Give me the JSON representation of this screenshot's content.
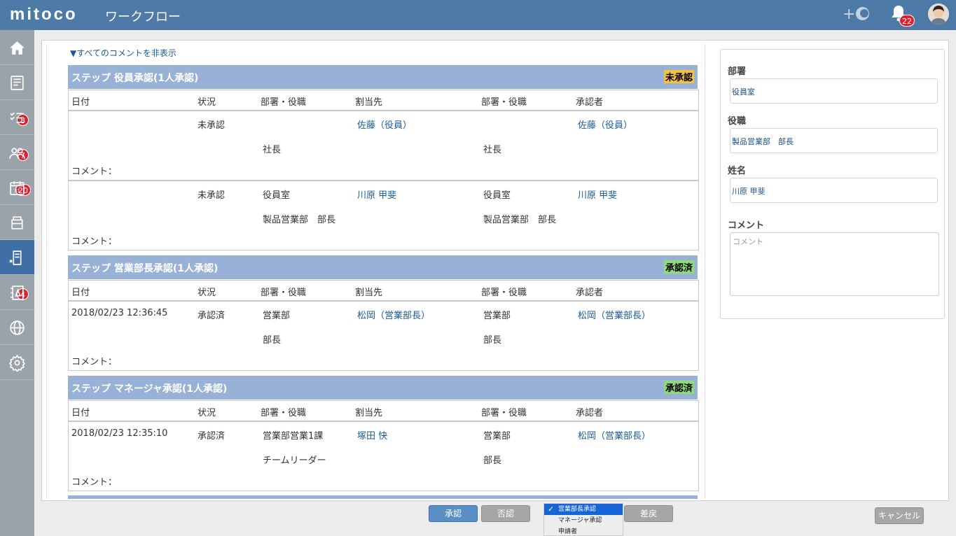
{
  "app": {
    "logo": "mitoco",
    "title": "ワークフロー"
  },
  "header": {
    "notification_count": "22"
  },
  "sidebar": {
    "items": [
      {
        "icon": "home-icon",
        "badge": ""
      },
      {
        "icon": "news-icon",
        "badge": "8"
      },
      {
        "icon": "todo-icon",
        "badge": "7"
      },
      {
        "icon": "group-icon",
        "badge": "20"
      },
      {
        "icon": "calendar-icon",
        "badge": ""
      },
      {
        "icon": "cabinet-icon",
        "badge": ""
      },
      {
        "icon": "workflow-icon",
        "badge": "4",
        "active": true
      },
      {
        "icon": "report-icon",
        "badge": ""
      },
      {
        "icon": "globe-icon",
        "badge": ""
      },
      {
        "icon": "gear-icon",
        "badge": ""
      }
    ]
  },
  "comments_toggle": "▼すべてのコメントを非表示",
  "columns": [
    "日付",
    "状況",
    "部署・役職",
    "割当先",
    "部署・役職",
    "承認者"
  ],
  "comment_label": "コメント：",
  "steps": [
    {
      "title": "ステップ 役員承認(1人承認)",
      "status": "未承認",
      "rows": [
        {
          "date": "",
          "state": "未承認",
          "dept1": "",
          "role1": "社長",
          "assignee": "佐藤（役員）",
          "dept2": "",
          "role2": "社長",
          "approver": "佐藤（役員）"
        },
        {
          "date": "",
          "state": "未承認",
          "dept1": "役員室",
          "role1": "製品営業部　部長",
          "assignee": "川原 甲斐",
          "dept2": "役員室",
          "role2": "製品営業部　部長",
          "approver": "川原 甲斐"
        }
      ]
    },
    {
      "title": "ステップ 営業部長承認(1人承認)",
      "status": "承認済",
      "rows": [
        {
          "date": "2018/02/23 12:36:45",
          "state": "承認済",
          "dept1": "営業部",
          "role1": "部長",
          "assignee": "松岡（営業部長）",
          "dept2": "営業部",
          "role2": "部長",
          "approver": "松岡（営業部長）"
        }
      ]
    },
    {
      "title": "ステップ マネージャ承認(1人承認)",
      "status": "承認済",
      "rows": [
        {
          "date": "2018/02/23 12:35:10",
          "state": "承認済",
          "dept1": "営業部営業1課",
          "role1": "チームリーダー",
          "assignee": "塚田 快",
          "dept2": "営業部",
          "role2": "部長",
          "approver": "松岡（営業部長）"
        }
      ]
    }
  ],
  "form": {
    "dept_label": "部署",
    "dept_value": "役員室",
    "title_label": "役職",
    "title_value": "製品営業部　部長",
    "name_label": "姓名",
    "name_value": "川原 甲斐",
    "comment_label": "コメント",
    "comment_placeholder": "コメント"
  },
  "actions": {
    "approve": "承認",
    "reject": "否認",
    "return": "差戻",
    "cancel": "キャンセル",
    "return_options": [
      "営業部長承認",
      "マネージャ承認",
      "申請者"
    ],
    "return_selected": "営業部長承認"
  },
  "colors": {
    "header": "#4e7aa8",
    "step_header": "#97b2d6",
    "pending": "#f6c13f",
    "approved": "#8fda7a",
    "badge": "#e02030"
  }
}
